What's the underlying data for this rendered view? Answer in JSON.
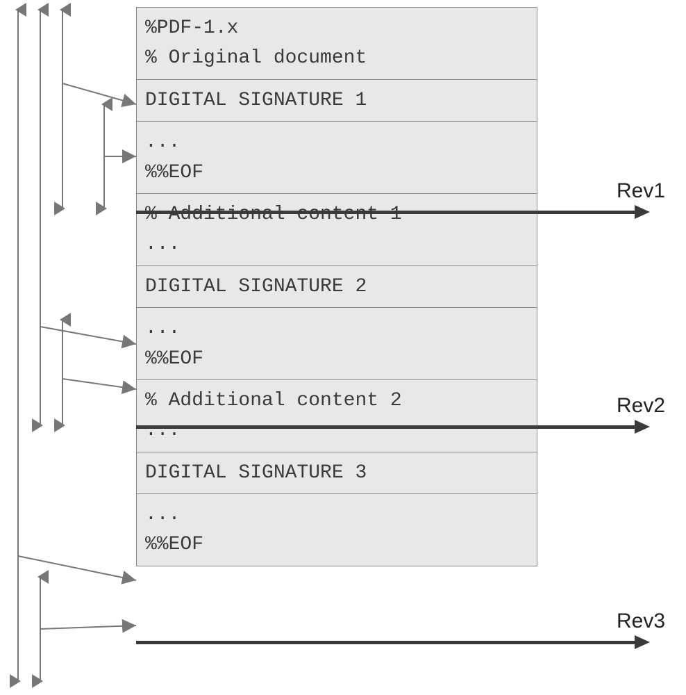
{
  "cells": {
    "c0": "%PDF-1.x\n% Original document",
    "c1": "DIGITAL SIGNATURE 1",
    "c2": "...\n%%EOF",
    "c3": "% Additional content 1\n...",
    "c4": "DIGITAL SIGNATURE 2",
    "c5": "...\n%%EOF",
    "c6": "% Additional content 2\n...",
    "c7": "DIGITAL SIGNATURE 3",
    "c8": "...\n%%EOF"
  },
  "revisions": {
    "r1": "Rev1",
    "r2": "Rev2",
    "r3": "Rev3"
  }
}
